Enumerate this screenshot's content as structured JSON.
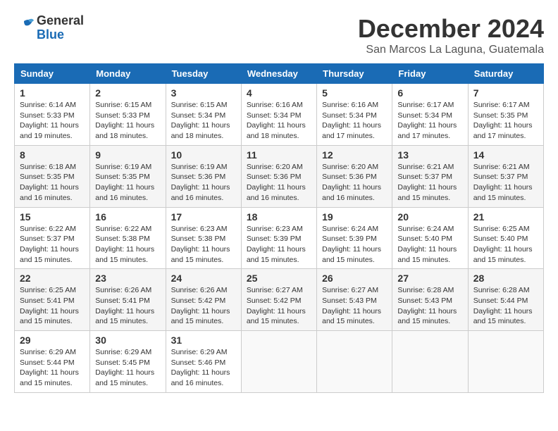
{
  "header": {
    "logo_general": "General",
    "logo_blue": "Blue",
    "month_title": "December 2024",
    "location": "San Marcos La Laguna, Guatemala"
  },
  "days_of_week": [
    "Sunday",
    "Monday",
    "Tuesday",
    "Wednesday",
    "Thursday",
    "Friday",
    "Saturday"
  ],
  "weeks": [
    [
      {
        "day": "1",
        "sunrise": "Sunrise: 6:14 AM",
        "sunset": "Sunset: 5:33 PM",
        "daylight": "Daylight: 11 hours and 19 minutes."
      },
      {
        "day": "2",
        "sunrise": "Sunrise: 6:15 AM",
        "sunset": "Sunset: 5:33 PM",
        "daylight": "Daylight: 11 hours and 18 minutes."
      },
      {
        "day": "3",
        "sunrise": "Sunrise: 6:15 AM",
        "sunset": "Sunset: 5:34 PM",
        "daylight": "Daylight: 11 hours and 18 minutes."
      },
      {
        "day": "4",
        "sunrise": "Sunrise: 6:16 AM",
        "sunset": "Sunset: 5:34 PM",
        "daylight": "Daylight: 11 hours and 18 minutes."
      },
      {
        "day": "5",
        "sunrise": "Sunrise: 6:16 AM",
        "sunset": "Sunset: 5:34 PM",
        "daylight": "Daylight: 11 hours and 17 minutes."
      },
      {
        "day": "6",
        "sunrise": "Sunrise: 6:17 AM",
        "sunset": "Sunset: 5:34 PM",
        "daylight": "Daylight: 11 hours and 17 minutes."
      },
      {
        "day": "7",
        "sunrise": "Sunrise: 6:17 AM",
        "sunset": "Sunset: 5:35 PM",
        "daylight": "Daylight: 11 hours and 17 minutes."
      }
    ],
    [
      {
        "day": "8",
        "sunrise": "Sunrise: 6:18 AM",
        "sunset": "Sunset: 5:35 PM",
        "daylight": "Daylight: 11 hours and 16 minutes."
      },
      {
        "day": "9",
        "sunrise": "Sunrise: 6:19 AM",
        "sunset": "Sunset: 5:35 PM",
        "daylight": "Daylight: 11 hours and 16 minutes."
      },
      {
        "day": "10",
        "sunrise": "Sunrise: 6:19 AM",
        "sunset": "Sunset: 5:36 PM",
        "daylight": "Daylight: 11 hours and 16 minutes."
      },
      {
        "day": "11",
        "sunrise": "Sunrise: 6:20 AM",
        "sunset": "Sunset: 5:36 PM",
        "daylight": "Daylight: 11 hours and 16 minutes."
      },
      {
        "day": "12",
        "sunrise": "Sunrise: 6:20 AM",
        "sunset": "Sunset: 5:36 PM",
        "daylight": "Daylight: 11 hours and 16 minutes."
      },
      {
        "day": "13",
        "sunrise": "Sunrise: 6:21 AM",
        "sunset": "Sunset: 5:37 PM",
        "daylight": "Daylight: 11 hours and 15 minutes."
      },
      {
        "day": "14",
        "sunrise": "Sunrise: 6:21 AM",
        "sunset": "Sunset: 5:37 PM",
        "daylight": "Daylight: 11 hours and 15 minutes."
      }
    ],
    [
      {
        "day": "15",
        "sunrise": "Sunrise: 6:22 AM",
        "sunset": "Sunset: 5:37 PM",
        "daylight": "Daylight: 11 hours and 15 minutes."
      },
      {
        "day": "16",
        "sunrise": "Sunrise: 6:22 AM",
        "sunset": "Sunset: 5:38 PM",
        "daylight": "Daylight: 11 hours and 15 minutes."
      },
      {
        "day": "17",
        "sunrise": "Sunrise: 6:23 AM",
        "sunset": "Sunset: 5:38 PM",
        "daylight": "Daylight: 11 hours and 15 minutes."
      },
      {
        "day": "18",
        "sunrise": "Sunrise: 6:23 AM",
        "sunset": "Sunset: 5:39 PM",
        "daylight": "Daylight: 11 hours and 15 minutes."
      },
      {
        "day": "19",
        "sunrise": "Sunrise: 6:24 AM",
        "sunset": "Sunset: 5:39 PM",
        "daylight": "Daylight: 11 hours and 15 minutes."
      },
      {
        "day": "20",
        "sunrise": "Sunrise: 6:24 AM",
        "sunset": "Sunset: 5:40 PM",
        "daylight": "Daylight: 11 hours and 15 minutes."
      },
      {
        "day": "21",
        "sunrise": "Sunrise: 6:25 AM",
        "sunset": "Sunset: 5:40 PM",
        "daylight": "Daylight: 11 hours and 15 minutes."
      }
    ],
    [
      {
        "day": "22",
        "sunrise": "Sunrise: 6:25 AM",
        "sunset": "Sunset: 5:41 PM",
        "daylight": "Daylight: 11 hours and 15 minutes."
      },
      {
        "day": "23",
        "sunrise": "Sunrise: 6:26 AM",
        "sunset": "Sunset: 5:41 PM",
        "daylight": "Daylight: 11 hours and 15 minutes."
      },
      {
        "day": "24",
        "sunrise": "Sunrise: 6:26 AM",
        "sunset": "Sunset: 5:42 PM",
        "daylight": "Daylight: 11 hours and 15 minutes."
      },
      {
        "day": "25",
        "sunrise": "Sunrise: 6:27 AM",
        "sunset": "Sunset: 5:42 PM",
        "daylight": "Daylight: 11 hours and 15 minutes."
      },
      {
        "day": "26",
        "sunrise": "Sunrise: 6:27 AM",
        "sunset": "Sunset: 5:43 PM",
        "daylight": "Daylight: 11 hours and 15 minutes."
      },
      {
        "day": "27",
        "sunrise": "Sunrise: 6:28 AM",
        "sunset": "Sunset: 5:43 PM",
        "daylight": "Daylight: 11 hours and 15 minutes."
      },
      {
        "day": "28",
        "sunrise": "Sunrise: 6:28 AM",
        "sunset": "Sunset: 5:44 PM",
        "daylight": "Daylight: 11 hours and 15 minutes."
      }
    ],
    [
      {
        "day": "29",
        "sunrise": "Sunrise: 6:29 AM",
        "sunset": "Sunset: 5:44 PM",
        "daylight": "Daylight: 11 hours and 15 minutes."
      },
      {
        "day": "30",
        "sunrise": "Sunrise: 6:29 AM",
        "sunset": "Sunset: 5:45 PM",
        "daylight": "Daylight: 11 hours and 15 minutes."
      },
      {
        "day": "31",
        "sunrise": "Sunrise: 6:29 AM",
        "sunset": "Sunset: 5:46 PM",
        "daylight": "Daylight: 11 hours and 16 minutes."
      },
      null,
      null,
      null,
      null
    ]
  ]
}
